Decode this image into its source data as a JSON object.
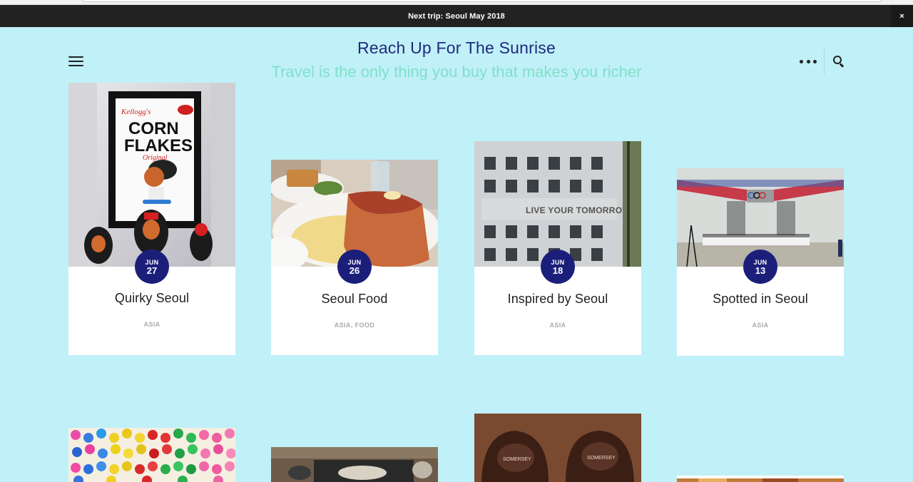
{
  "announcement": {
    "text": "Next trip: Seoul May 2018",
    "close_label": "×"
  },
  "header": {
    "title": "Reach Up For The Sunrise",
    "description": "Travel is the only thing you buy that makes you richer",
    "menu_icon": "hamburger-menu-icon",
    "more_icon": "ellipsis-icon",
    "search_icon": "search-icon"
  },
  "posts": [
    {
      "title": "Quirky Seoul",
      "month": "JUN",
      "day": "27",
      "categories": [
        "ASIA"
      ]
    },
    {
      "title": "Seoul Food",
      "month": "JUN",
      "day": "26",
      "categories": [
        "ASIA",
        "FOOD"
      ]
    },
    {
      "title": "Inspired by Seoul",
      "month": "JUN",
      "day": "18",
      "categories": [
        "ASIA"
      ]
    },
    {
      "title": "Spotted in Seoul",
      "month": "JUN",
      "day": "13",
      "categories": [
        "ASIA"
      ]
    }
  ],
  "colors": {
    "page_background": "#c0f0f8",
    "announcement_bar": "#222222",
    "title": "#1f2a7c",
    "tagline": "#7fe0cc",
    "date_badge": "#1c1f7a",
    "category_text": "#aaaaaa"
  }
}
